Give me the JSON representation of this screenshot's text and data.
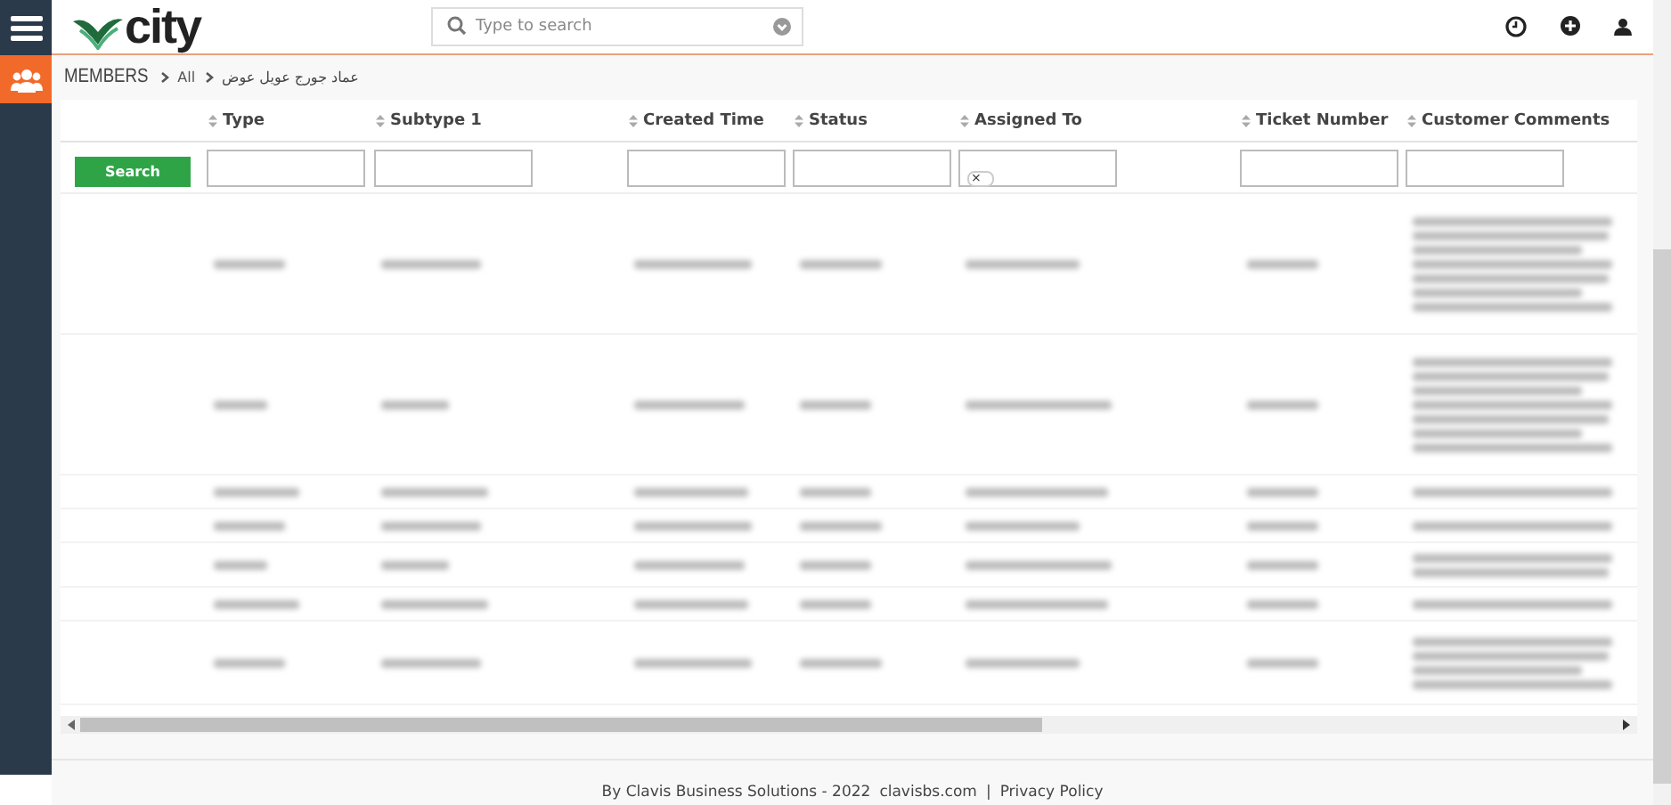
{
  "header": {
    "logo": "city",
    "search": {
      "placeholder": "Type to search"
    }
  },
  "breadcrumb": [
    "MEMBERS",
    "All",
    "عماد جورج عويل عوض"
  ],
  "table": {
    "columns": [
      "Type",
      "Subtype 1",
      "Created Time",
      "Status",
      "Assigned To",
      "Ticket Number",
      "Customer Comments"
    ],
    "search_button": "Search",
    "assigned_filter_tag": "×",
    "rows": [
      {
        "kind": "tall"
      },
      {
        "kind": "tall"
      },
      {
        "kind": "single"
      },
      {
        "kind": "single"
      },
      {
        "kind": "double"
      },
      {
        "kind": "single"
      },
      {
        "kind": "quad"
      }
    ]
  },
  "footer": {
    "text": "By Clavis Business Solutions - 2022",
    "link": "clavisbs.com",
    "separator": "|",
    "policy": "Privacy Policy"
  }
}
